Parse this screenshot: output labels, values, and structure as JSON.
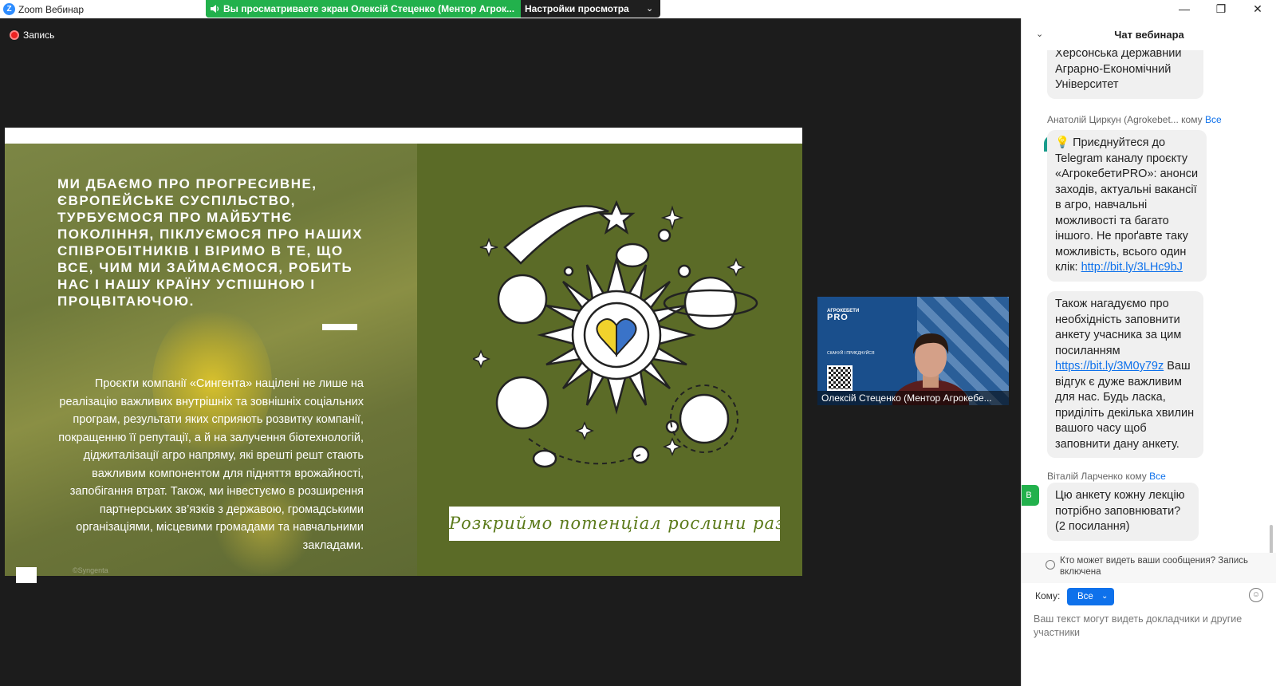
{
  "titlebar": {
    "app_logo": "Z",
    "app_title": "Zoom Вебинар"
  },
  "share": {
    "banner_text": "Вы просматриваете экран Олексій Стеценко (Ментор Агрок...",
    "view_settings_label": "Настройки просмотра",
    "chevron": "⌄"
  },
  "window": {
    "minimize": "—",
    "restore": "❐",
    "close": "✕"
  },
  "recording": {
    "label": "Запись"
  },
  "slide": {
    "headline": "Ми дбаємо про прогресивне, європейське суспільство, турбуємося про майбутнє покоління, піклуємося про наших співробітників і віримо в те, що все, чим ми займаємося, робить нас і нашу країну успішною і процвітаючою.",
    "body": "Проєкти компанії «Сингента» націлені не лише на реалізацію важливих внутрішніх та зовнішніх соціальних програм, результати яких сприяють розвитку компанії, покращенню її репутації, а й на залучення біотехнологій, діджиталізації агро напряму, які врешті решт стають важливим компонентом для підняття врожайності, запобігання втрат. Також, ми інвестуємо в розширення партнерських зв’язків з державою, громадськими організаціями, місцевими громадами та навчальними закладами.",
    "slogan": "Розкриймо потенціал рослини разом",
    "watermark": "©Syngenta"
  },
  "video_tile": {
    "brand_line1": "АГРОКЕБЕТИ",
    "brand_line2": "PRO",
    "scan_text": "СКАНУЙ І ПРИЄДНУЙСЯ",
    "participant_name": "Олексій Стеценко (Ментор Агрокебе..."
  },
  "chat": {
    "title": "Чат вебинара",
    "collapse_icon": "⌄",
    "messages": [
      {
        "text": "Херсонська Державний Аграрно-Економічний Університет"
      },
      {
        "sender": "Анатолій Циркун (Agrokebet...",
        "to_label": "кому",
        "to": "Все",
        "avatar": "",
        "text_before": "💡 Приєднуйтеся до Telegram каналу проєкту «АгрокебетиPRO»: анонси заходів, актуальні вакансії в агро, навчальні можливості та багато іншого. Не проґавте таку можливість, всього один клік: ",
        "link": "http://bit.ly/3LHc9bJ"
      },
      {
        "text_before": "Також нагадуємо про необхідність заповнити анкету учасника за цим посиланням ",
        "link": "https://bit.ly/3M0y79z",
        "text_after": " Ваш відгук є дуже важливим для нас. Будь ласка, приділіть декілька хвилин вашого часу щоб заповнити дану анкету."
      },
      {
        "sender": "Віталій Ларченко",
        "to_label": "кому",
        "to": "Все",
        "avatar": "В",
        "text": "Цю анкету кожну лекцію потрібно заповнювати? (2 посилання)"
      }
    ],
    "visibility_note": "Кто может видеть ваши сообщения? Запись включена",
    "to_label": "Кому:",
    "to_value": "Все",
    "to_chevron": "⌄",
    "emoji_icon": "☺",
    "input_placeholder": "Ваш текст могут видеть докладчики и другие участники"
  },
  "colors": {
    "accent": "#0e71eb",
    "share_green": "#22b14c",
    "slide_green": "#5b6b27",
    "avatar_green": "#22b14c",
    "avatar_teal": "#1a9c8c"
  }
}
